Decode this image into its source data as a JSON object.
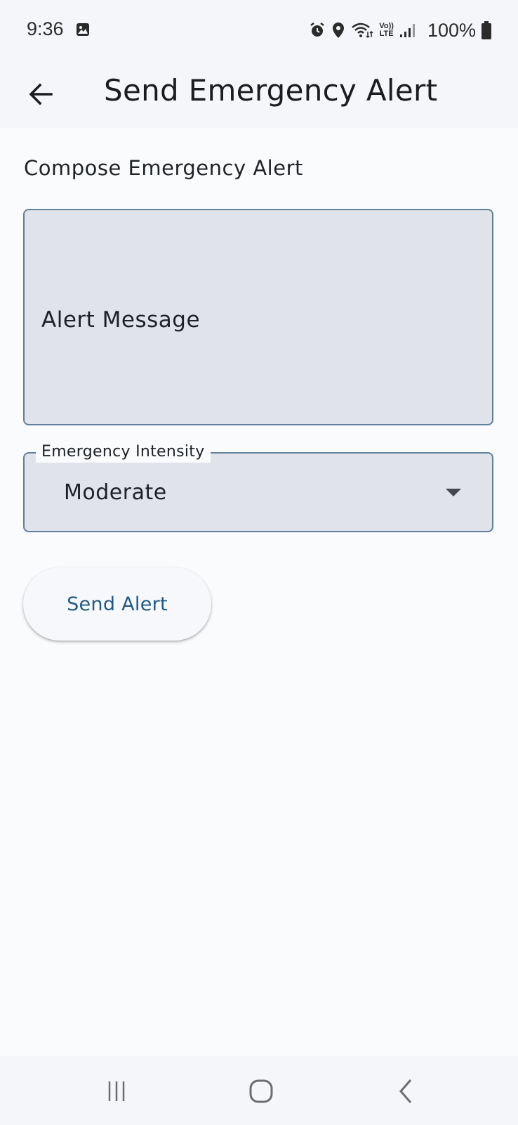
{
  "status_bar": {
    "time": "9:36",
    "battery": "100%",
    "icons": [
      "gallery-icon",
      "alarm-icon",
      "location-icon",
      "wifi-icon",
      "volte-icon",
      "signal-icon",
      "battery-icon"
    ],
    "volte_label_top": "Vo))",
    "volte_label_bottom": "LTE"
  },
  "app_bar": {
    "title": "Send Emergency Alert",
    "back_icon": "arrow-back-icon"
  },
  "form": {
    "heading": "Compose Emergency Alert",
    "message_placeholder": "Alert Message",
    "intensity_label": "Emergency Intensity",
    "intensity_value": "Moderate",
    "send_label": "Send Alert"
  },
  "nav_bar": {
    "icons": [
      "recent-apps-icon",
      "home-icon",
      "back-icon"
    ]
  },
  "colors": {
    "accent": "#1f5a88",
    "field_border": "#5f7f9b",
    "field_fill": "#e0e3e9"
  }
}
